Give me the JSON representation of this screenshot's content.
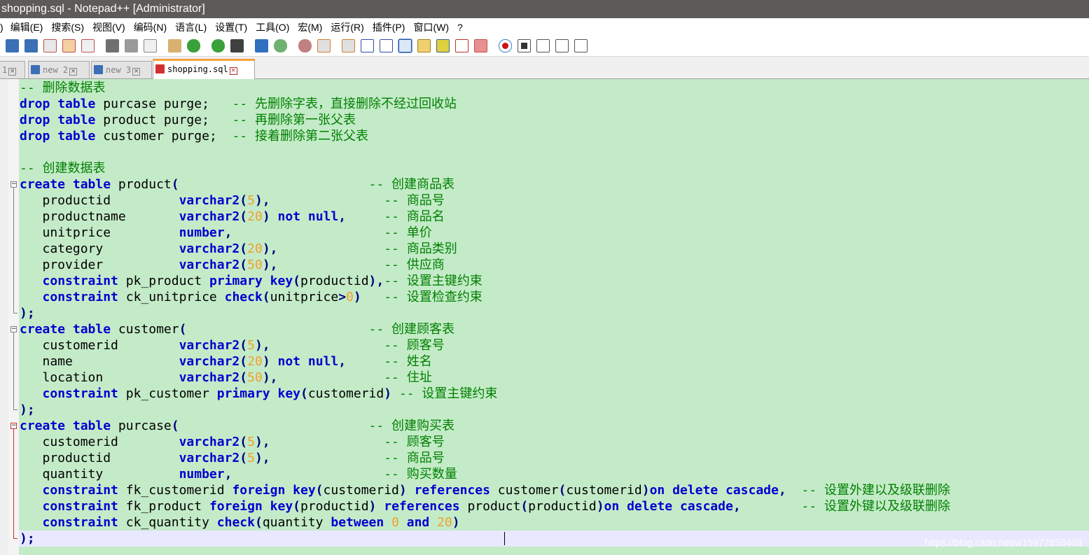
{
  "window": {
    "title": "shopping.sql - Notepad++ [Administrator]"
  },
  "menu": [
    ")",
    "编辑(E)",
    "搜索(S)",
    "视图(V)",
    "编码(N)",
    "语言(L)",
    "设置(T)",
    "工具(O)",
    "宏(M)",
    "运行(R)",
    "插件(P)",
    "窗口(W)",
    "?"
  ],
  "toolbar": {
    "icons": [
      "new-file-icon",
      "save-icon",
      "save-all-icon",
      "close-icon",
      "close-all-icon",
      "print-icon",
      "cut-icon",
      "copy-icon",
      "paste-icon",
      "undo-icon",
      "redo-icon",
      "find-icon",
      "replace-icon",
      "zoom-in-icon",
      "zoom-out-icon",
      "sync-vertical-icon",
      "sync-horizontal-icon",
      "word-wrap-icon",
      "show-all-chars-icon",
      "indent-guide-icon",
      "doc-map-icon",
      "function-list-icon",
      "folder-workspace-icon",
      "monitoring-icon",
      "record-macro-icon",
      "stop-record-icon",
      "play-macro-icon",
      "run-macro-multiple-icon",
      "save-macro-icon"
    ]
  },
  "tabs": [
    {
      "label": "1",
      "active": false
    },
    {
      "label": "new 2",
      "active": false
    },
    {
      "label": "new 3",
      "active": false
    },
    {
      "label": "shopping.sql",
      "active": true
    }
  ],
  "editor": {
    "lines": [
      [
        [
          "cm",
          "-- 删除数据表"
        ]
      ],
      [
        [
          "kw",
          "drop"
        ],
        [
          "pl",
          " "
        ],
        [
          "kw",
          "table"
        ],
        [
          "pl",
          " purcase purge;   "
        ],
        [
          "cm",
          "-- 先删除字表，直接删除不经过回收站"
        ]
      ],
      [
        [
          "kw",
          "drop"
        ],
        [
          "pl",
          " "
        ],
        [
          "kw",
          "table"
        ],
        [
          "pl",
          " product purge;   "
        ],
        [
          "cm",
          "-- 再删除第一张父表"
        ]
      ],
      [
        [
          "kw",
          "drop"
        ],
        [
          "pl",
          " "
        ],
        [
          "kw",
          "table"
        ],
        [
          "pl",
          " customer purge;  "
        ],
        [
          "cm",
          "-- 接着删除第二张父表"
        ]
      ],
      [],
      [
        [
          "cm",
          "-- 创建数据表"
        ]
      ],
      [
        [
          "kw",
          "create"
        ],
        [
          "pl",
          " "
        ],
        [
          "kw",
          "table"
        ],
        [
          "pl",
          " product"
        ],
        [
          "op",
          "("
        ],
        [
          "pl",
          "                         "
        ],
        [
          "cm",
          "-- 创建商品表"
        ]
      ],
      [
        [
          "pl",
          "   productid         "
        ],
        [
          "kw",
          "varchar2"
        ],
        [
          "op",
          "("
        ],
        [
          "num",
          "5"
        ],
        [
          "op",
          "),"
        ],
        [
          "pl",
          "               "
        ],
        [
          "cm",
          "-- 商品号"
        ]
      ],
      [
        [
          "pl",
          "   productname       "
        ],
        [
          "kw",
          "varchar2"
        ],
        [
          "op",
          "("
        ],
        [
          "num",
          "20"
        ],
        [
          "op",
          ")"
        ],
        [
          "pl",
          " "
        ],
        [
          "kw",
          "not"
        ],
        [
          "pl",
          " "
        ],
        [
          "kw",
          "null"
        ],
        [
          "op",
          ","
        ],
        [
          "pl",
          "     "
        ],
        [
          "cm",
          "-- 商品名"
        ]
      ],
      [
        [
          "pl",
          "   unitprice         "
        ],
        [
          "kw",
          "number"
        ],
        [
          "op",
          ","
        ],
        [
          "pl",
          "                    "
        ],
        [
          "cm",
          "-- 单价"
        ]
      ],
      [
        [
          "pl",
          "   category          "
        ],
        [
          "kw",
          "varchar2"
        ],
        [
          "op",
          "("
        ],
        [
          "num",
          "20"
        ],
        [
          "op",
          "),"
        ],
        [
          "pl",
          "              "
        ],
        [
          "cm",
          "-- 商品类别"
        ]
      ],
      [
        [
          "pl",
          "   provider          "
        ],
        [
          "kw",
          "varchar2"
        ],
        [
          "op",
          "("
        ],
        [
          "num",
          "50"
        ],
        [
          "op",
          "),"
        ],
        [
          "pl",
          "              "
        ],
        [
          "cm",
          "-- 供应商"
        ]
      ],
      [
        [
          "pl",
          "   "
        ],
        [
          "kw",
          "constraint"
        ],
        [
          "pl",
          " pk_product "
        ],
        [
          "kw",
          "primary"
        ],
        [
          "pl",
          " "
        ],
        [
          "kw",
          "key"
        ],
        [
          "op",
          "("
        ],
        [
          "pl",
          "productid"
        ],
        [
          "op",
          "),"
        ],
        [
          "cm",
          "-- 设置主键约束"
        ]
      ],
      [
        [
          "pl",
          "   "
        ],
        [
          "kw",
          "constraint"
        ],
        [
          "pl",
          " ck_unitprice "
        ],
        [
          "kw",
          "check"
        ],
        [
          "op",
          "("
        ],
        [
          "pl",
          "unitprice"
        ],
        [
          "op",
          ">"
        ],
        [
          "num",
          "0"
        ],
        [
          "op",
          ")"
        ],
        [
          "pl",
          "   "
        ],
        [
          "cm",
          "-- 设置检查约束"
        ]
      ],
      [
        [
          "op",
          ");"
        ]
      ],
      [
        [
          "kw",
          "create"
        ],
        [
          "pl",
          " "
        ],
        [
          "kw",
          "table"
        ],
        [
          "pl",
          " customer"
        ],
        [
          "op",
          "("
        ],
        [
          "pl",
          "                        "
        ],
        [
          "cm",
          "-- 创建顾客表"
        ]
      ],
      [
        [
          "pl",
          "   customerid        "
        ],
        [
          "kw",
          "varchar2"
        ],
        [
          "op",
          "("
        ],
        [
          "num",
          "5"
        ],
        [
          "op",
          "),"
        ],
        [
          "pl",
          "               "
        ],
        [
          "cm",
          "-- 顾客号"
        ]
      ],
      [
        [
          "pl",
          "   name              "
        ],
        [
          "kw",
          "varchar2"
        ],
        [
          "op",
          "("
        ],
        [
          "num",
          "20"
        ],
        [
          "op",
          ")"
        ],
        [
          "pl",
          " "
        ],
        [
          "kw",
          "not"
        ],
        [
          "pl",
          " "
        ],
        [
          "kw",
          "null"
        ],
        [
          "op",
          ","
        ],
        [
          "pl",
          "     "
        ],
        [
          "cm",
          "-- 姓名"
        ]
      ],
      [
        [
          "pl",
          "   location          "
        ],
        [
          "kw",
          "varchar2"
        ],
        [
          "op",
          "("
        ],
        [
          "num",
          "50"
        ],
        [
          "op",
          "),"
        ],
        [
          "pl",
          "              "
        ],
        [
          "cm",
          "-- 住址"
        ]
      ],
      [
        [
          "pl",
          "   "
        ],
        [
          "kw",
          "constraint"
        ],
        [
          "pl",
          " pk_customer "
        ],
        [
          "kw",
          "primary"
        ],
        [
          "pl",
          " "
        ],
        [
          "kw",
          "key"
        ],
        [
          "op",
          "("
        ],
        [
          "pl",
          "customerid"
        ],
        [
          "op",
          ")"
        ],
        [
          "pl",
          " "
        ],
        [
          "cm",
          "-- 设置主键约束"
        ]
      ],
      [
        [
          "op",
          ");"
        ]
      ],
      [
        [
          "kw",
          "create"
        ],
        [
          "pl",
          " "
        ],
        [
          "kw",
          "table"
        ],
        [
          "pl",
          " purcase"
        ],
        [
          "op",
          "("
        ],
        [
          "pl",
          "                         "
        ],
        [
          "cm",
          "-- 创建购买表"
        ]
      ],
      [
        [
          "pl",
          "   customerid        "
        ],
        [
          "kw",
          "varchar2"
        ],
        [
          "op",
          "("
        ],
        [
          "num",
          "5"
        ],
        [
          "op",
          "),"
        ],
        [
          "pl",
          "               "
        ],
        [
          "cm",
          "-- 顾客号"
        ]
      ],
      [
        [
          "pl",
          "   productid         "
        ],
        [
          "kw",
          "varchar2"
        ],
        [
          "op",
          "("
        ],
        [
          "num",
          "5"
        ],
        [
          "op",
          "),"
        ],
        [
          "pl",
          "               "
        ],
        [
          "cm",
          "-- 商品号"
        ]
      ],
      [
        [
          "pl",
          "   quantity          "
        ],
        [
          "kw",
          "number"
        ],
        [
          "op",
          ","
        ],
        [
          "pl",
          "                    "
        ],
        [
          "cm",
          "-- 购买数量"
        ]
      ],
      [
        [
          "pl",
          "   "
        ],
        [
          "kw",
          "constraint"
        ],
        [
          "pl",
          " fk_customerid "
        ],
        [
          "kw",
          "foreign"
        ],
        [
          "pl",
          " "
        ],
        [
          "kw",
          "key"
        ],
        [
          "op",
          "("
        ],
        [
          "pl",
          "customerid"
        ],
        [
          "op",
          ")"
        ],
        [
          "pl",
          " "
        ],
        [
          "kw",
          "references"
        ],
        [
          "pl",
          " customer"
        ],
        [
          "op",
          "("
        ],
        [
          "pl",
          "customerid"
        ],
        [
          "op",
          ")"
        ],
        [
          "kw",
          "on"
        ],
        [
          "pl",
          " "
        ],
        [
          "kw",
          "delete"
        ],
        [
          "pl",
          " "
        ],
        [
          "kw",
          "cascade"
        ],
        [
          "op",
          ","
        ],
        [
          "pl",
          "  "
        ],
        [
          "cm",
          "-- 设置外建以及级联删除"
        ]
      ],
      [
        [
          "pl",
          "   "
        ],
        [
          "kw",
          "constraint"
        ],
        [
          "pl",
          " fk_product "
        ],
        [
          "kw",
          "foreign"
        ],
        [
          "pl",
          " "
        ],
        [
          "kw",
          "key"
        ],
        [
          "op",
          "("
        ],
        [
          "pl",
          "productid"
        ],
        [
          "op",
          ")"
        ],
        [
          "pl",
          " "
        ],
        [
          "kw",
          "references"
        ],
        [
          "pl",
          " product"
        ],
        [
          "op",
          "("
        ],
        [
          "pl",
          "productid"
        ],
        [
          "op",
          ")"
        ],
        [
          "kw",
          "on"
        ],
        [
          "pl",
          " "
        ],
        [
          "kw",
          "delete"
        ],
        [
          "pl",
          " "
        ],
        [
          "kw",
          "cascade"
        ],
        [
          "op",
          ","
        ],
        [
          "pl",
          "        "
        ],
        [
          "cm",
          "-- 设置外键以及级联删除"
        ]
      ],
      [
        [
          "pl",
          "   "
        ],
        [
          "kw",
          "constraint"
        ],
        [
          "pl",
          " ck_quantity "
        ],
        [
          "kw",
          "check"
        ],
        [
          "op",
          "("
        ],
        [
          "pl",
          "quantity "
        ],
        [
          "kw",
          "between"
        ],
        [
          "pl",
          " "
        ],
        [
          "num",
          "0"
        ],
        [
          "pl",
          " "
        ],
        [
          "kw",
          "and"
        ],
        [
          "pl",
          " "
        ],
        [
          "num",
          "20"
        ],
        [
          "op",
          ")"
        ]
      ],
      [
        [
          "op",
          ");"
        ]
      ]
    ],
    "caret_line": 28
  },
  "watermark": "https://blog.csdn.net/w15977858408"
}
